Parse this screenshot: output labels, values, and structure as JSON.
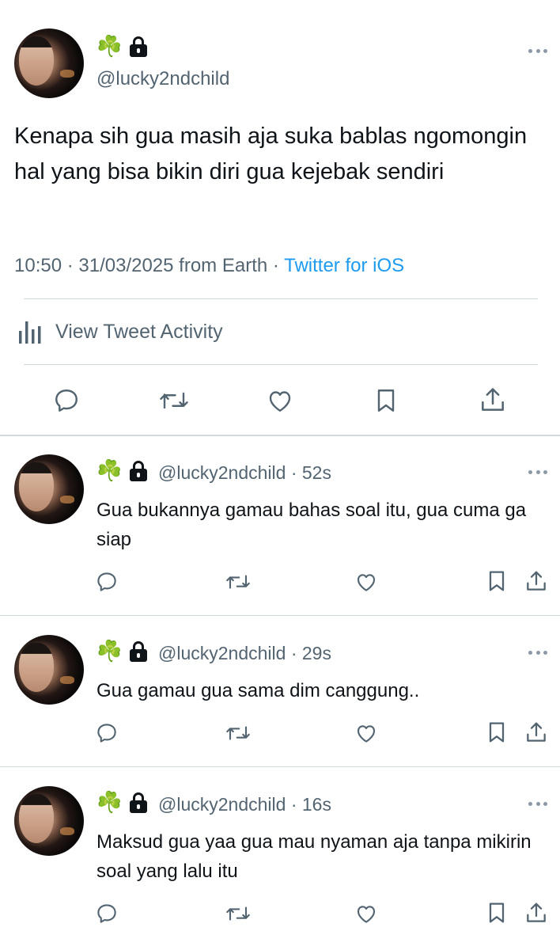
{
  "main_tweet": {
    "name_emoji": "☘️",
    "handle": "@lucky2ndchild",
    "text": "Kenapa sih gua masih aja suka bablas ngomongin hal yang bisa bikin diri gua kejebak sendiri",
    "meta_time": "10:50 · 31/03/2025 from Earth · ",
    "meta_client": "Twitter for iOS",
    "activity_label": "View Tweet Activity",
    "actions": [
      "reply-icon",
      "retweet-icon",
      "like-icon",
      "bookmark-icon",
      "share-icon"
    ]
  },
  "replies": [
    {
      "name_emoji": "☘️",
      "handle_time": "@lucky2ndchild · 52s",
      "text": "Gua bukannya gamau bahas soal itu, gua cuma ga siap"
    },
    {
      "name_emoji": "☘️",
      "handle_time": "@lucky2ndchild · 29s",
      "text": "Gua gamau gua sama dim canggung.."
    },
    {
      "name_emoji": "☘️",
      "handle_time": "@lucky2ndchild · 16s",
      "text": "Maksud gua yaa gua mau nyaman aja tanpa mikirin soal yang lalu itu"
    }
  ],
  "colors": {
    "accent": "#1d9bf0",
    "secondary_text": "#536471",
    "divider": "#cfd9de"
  }
}
